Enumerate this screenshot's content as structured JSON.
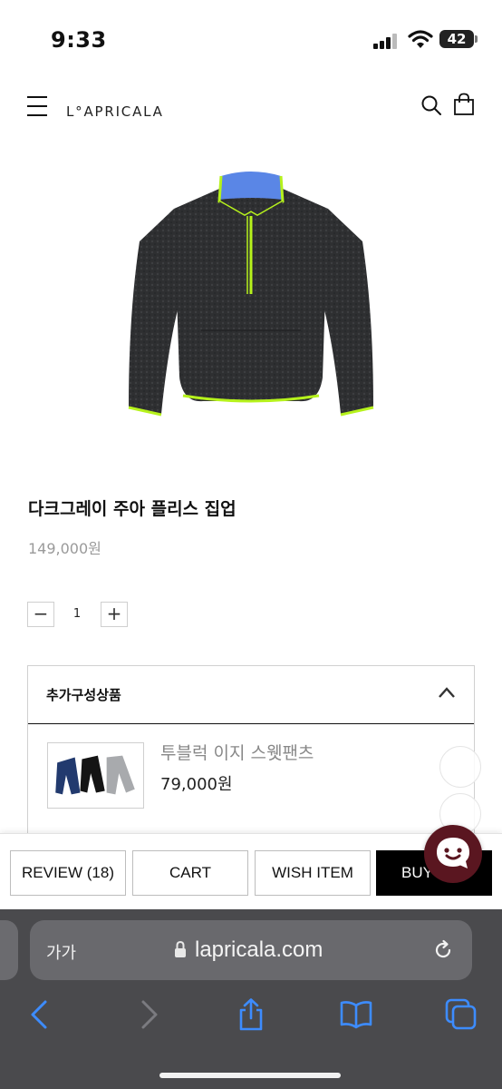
{
  "status_bar": {
    "time": "9:33",
    "battery": "42"
  },
  "header": {
    "logo": "L°APRICALA"
  },
  "product": {
    "name": "다크그레이 주아 플리스 집업",
    "price": "149,000원",
    "quantity": "1"
  },
  "addon": {
    "title": "추가구성상품",
    "items": [
      {
        "name": "투블럭 이지 스웻팬츠",
        "price": "79,000원"
      }
    ]
  },
  "actions": {
    "review": "REVIEW (18)",
    "cart": "CART",
    "wish": "WISH ITEM",
    "buy": "BUY"
  },
  "browser": {
    "text_size": "가가",
    "url": "lapricala.com"
  },
  "colors": {
    "accent_green": "#b6f21c",
    "collar_blue": "#5a86e6",
    "chat_bg": "#5a1620",
    "buy_bg": "#000000",
    "safari_bg": "#4a4a4d",
    "ios_blue": "#3d8cff"
  }
}
